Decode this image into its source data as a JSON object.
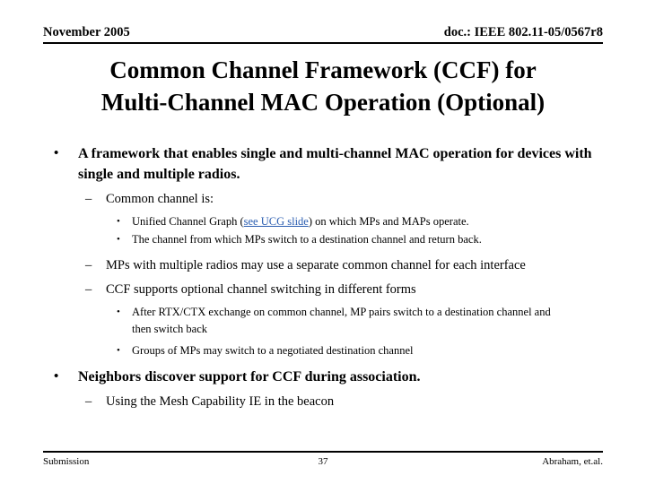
{
  "header": {
    "date": "November 2005",
    "doc_number": "doc.: IEEE 802.11-05/0567r8"
  },
  "title": {
    "line1": "Common Channel Framework (CCF) for",
    "line2": "Multi-Channel MAC Operation (Optional)"
  },
  "content": {
    "b1": "A framework that enables single and multi-channel MAC operation for devices with single and multiple radios.",
    "b1_s1": "Common channel is:",
    "b1_s1_a_pre": "Unified Channel Graph (",
    "b1_s1_a_link": "see UCG slide",
    "b1_s1_a_post": ") on which MPs and MAPs operate.",
    "b1_s1_b": "The channel from which MPs switch to a destination channel and return back.",
    "b1_s2": "MPs with multiple radios may use a separate common channel for each interface",
    "b1_s3": "CCF supports optional channel switching in different forms",
    "b1_s3_a": "After RTX/CTX exchange on common channel, MP pairs switch to a destination channel and then switch back",
    "b1_s3_b": "Groups of MPs may switch to a negotiated destination channel",
    "b2": "Neighbors discover support for CCF during association.",
    "b2_s1": "Using the Mesh Capability IE in the beacon"
  },
  "markers": {
    "disc": "•",
    "dash": "–"
  },
  "footer": {
    "left": "Submission",
    "page": "37",
    "right": "Abraham, et.al."
  },
  "colors": {
    "link": "#2a5db0",
    "text": "#000000",
    "background": "#ffffff"
  }
}
